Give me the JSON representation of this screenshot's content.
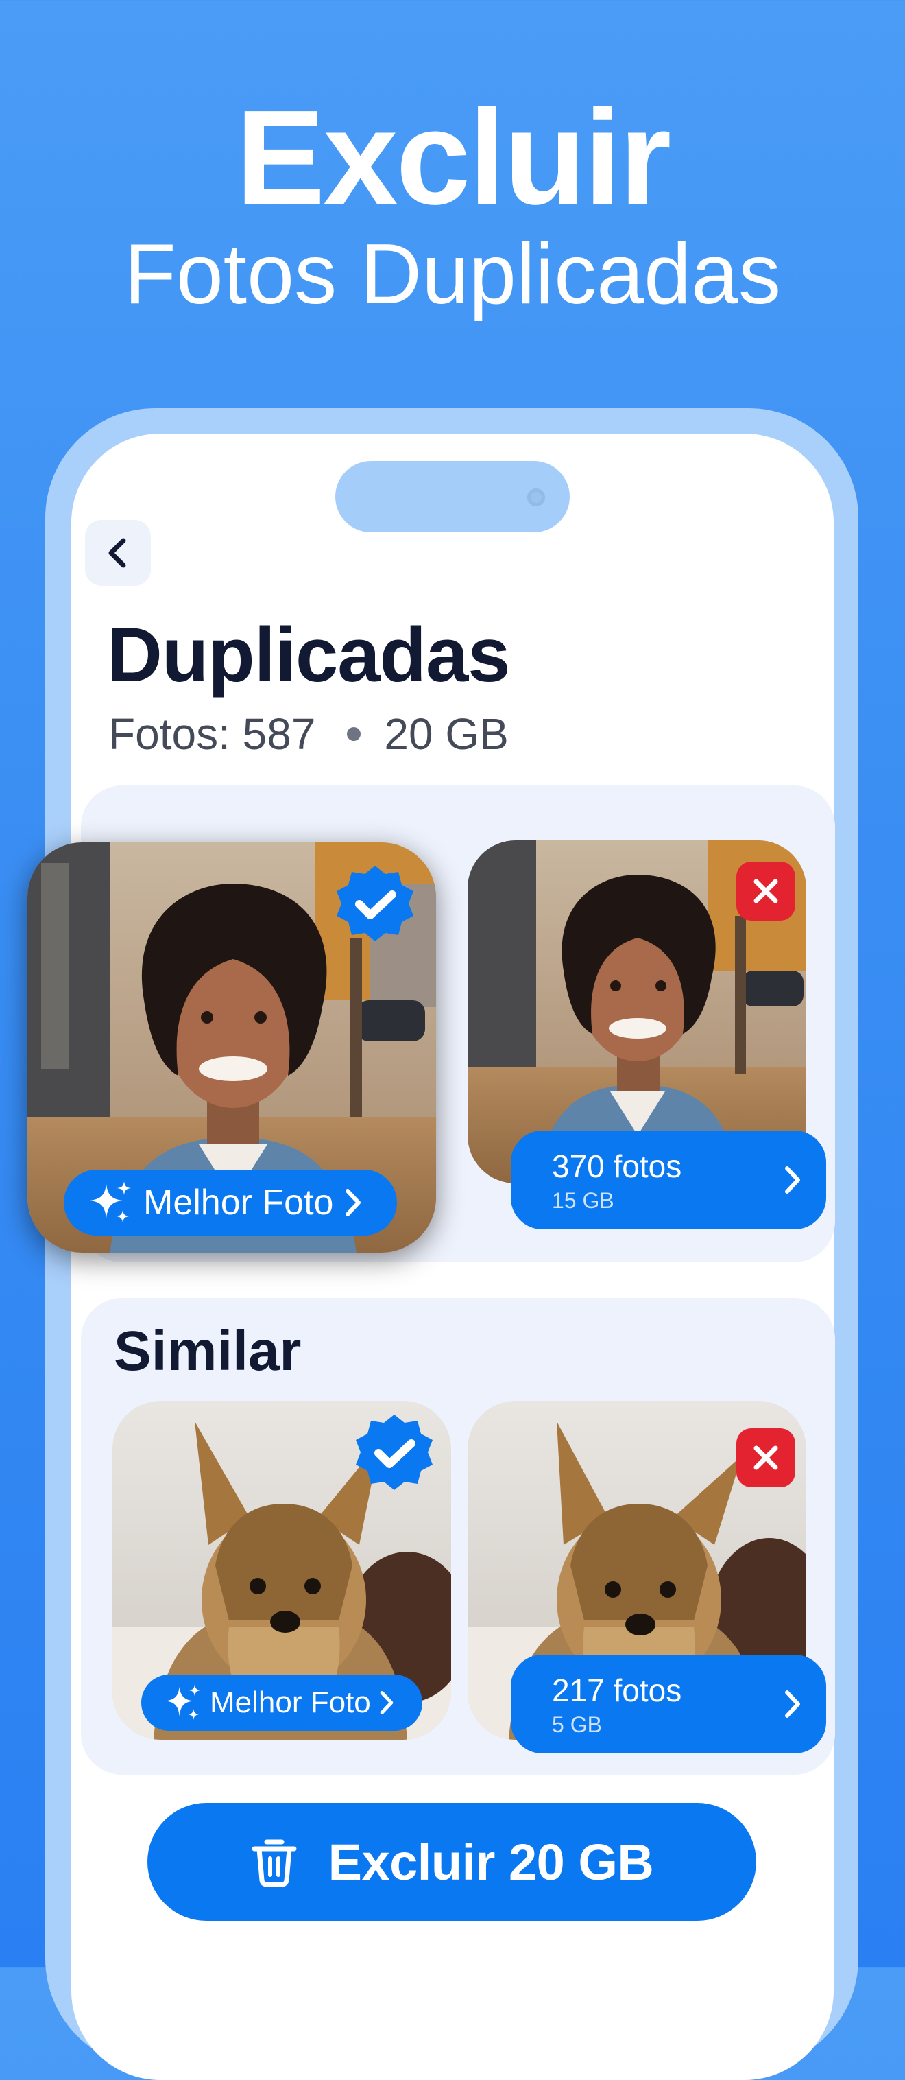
{
  "hero": {
    "title": "Excluir",
    "subtitle": "Fotos Duplicadas"
  },
  "screen": {
    "title": "Duplicadas",
    "stats": {
      "photos": "Fotos: 587",
      "size": "20 GB"
    }
  },
  "groups": [
    {
      "label": "",
      "best_badge": "Melhor Foto",
      "count": {
        "title": "370 fotos",
        "size": "15 GB"
      },
      "photo_subject": "woman-selfie-photo"
    },
    {
      "label": "Similar",
      "best_badge": "Melhor Foto",
      "count": {
        "title": "217 fotos",
        "size": "5 GB"
      },
      "photo_subject": "yorkshire-terrier-photo"
    }
  ],
  "delete_button": {
    "label": "Excluir 20 GB"
  },
  "colors": {
    "background": "#3b8ff3",
    "accent": "#0a78f0",
    "reject": "#e32330",
    "card": "#eef2fc",
    "title": "#121a33"
  },
  "icons": [
    "back-chevron-icon",
    "verified-check-icon",
    "close-icon",
    "sparkle-icon",
    "chevron-right-icon",
    "trash-icon"
  ]
}
